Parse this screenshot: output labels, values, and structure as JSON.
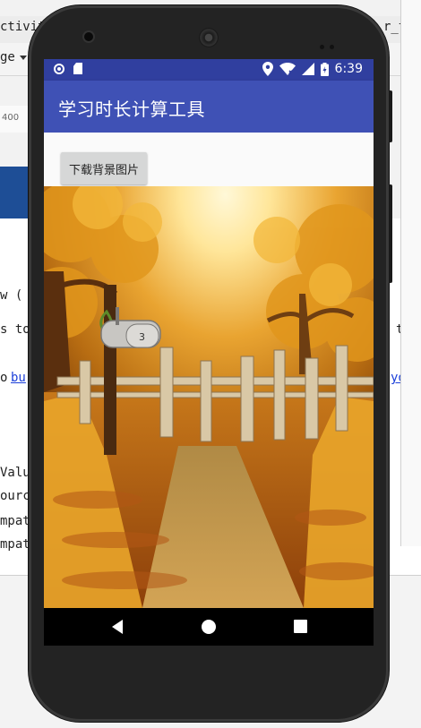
{
  "ide": {
    "tab_fragment": "ctivity",
    "tab_fragment_right": "r_t",
    "dropdown_fragment": "ge",
    "ruler_label": "400",
    "code_lines": [
      "w (",
      "s to",
      "o ",
      "Valu",
      "ourc",
      "mpat",
      "mpat"
    ],
    "link_fragment": "bu",
    "link_fragment_right": "yo",
    "right_fragment": "t"
  },
  "status_bar": {
    "time": "6:39",
    "icons": [
      "circle-icon",
      "sd-card-icon",
      "location-icon",
      "wifi-icon",
      "signal-icon",
      "battery-icon"
    ]
  },
  "app_bar": {
    "title": "学习时长计算工具",
    "color": "#3f51b5"
  },
  "content": {
    "download_button_label": "下载背景图片",
    "image_number": "3"
  },
  "nav_bar": {
    "icons": [
      "back-icon",
      "home-icon",
      "recents-icon"
    ]
  },
  "colors": {
    "status_bar": "#303f9f",
    "app_bar": "#3f51b5",
    "button": "#d6d7d7"
  }
}
